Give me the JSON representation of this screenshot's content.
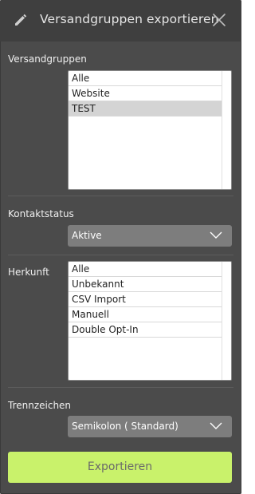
{
  "dialog": {
    "title": "Versandgruppen exportieren",
    "title_icon": "pencil-icon",
    "close_icon": "close-icon"
  },
  "versandgruppen": {
    "label": "Versandgruppen",
    "items": [
      {
        "label": "Alle",
        "selected": false
      },
      {
        "label": "Website",
        "selected": false
      },
      {
        "label": "TEST",
        "selected": true
      }
    ]
  },
  "kontaktstatus": {
    "label": "Kontaktstatus",
    "value": "Aktive"
  },
  "herkunft": {
    "label": "Herkunft",
    "items": [
      {
        "label": "Alle"
      },
      {
        "label": "Unbekannt"
      },
      {
        "label": "CSV Import"
      },
      {
        "label": "Manuell"
      },
      {
        "label": "Double Opt-In"
      }
    ]
  },
  "trennzeichen": {
    "label": "Trennzeichen",
    "value": "Semikolon ( Standard)"
  },
  "actions": {
    "export_label": "Exportieren"
  },
  "colors": {
    "dialog_bg": "#4b4b4b",
    "titlebar_bg": "#3f3f3f",
    "select_bg": "#7d7d7d",
    "export_bg": "#c9f26b",
    "selected_row": "#d4d4d4"
  }
}
